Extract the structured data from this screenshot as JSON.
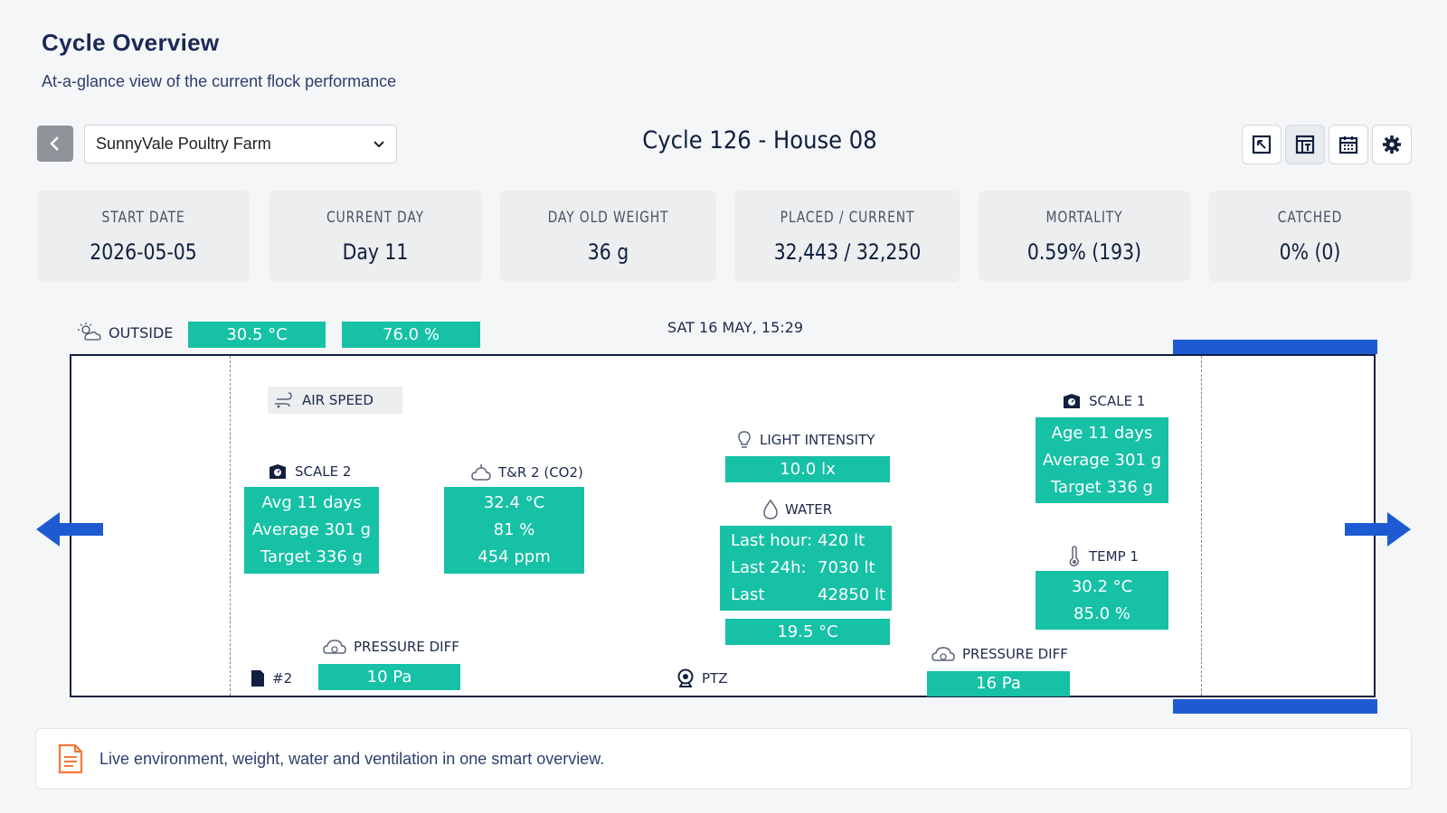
{
  "header": {
    "title": "Cycle Overview",
    "subtitle": "At-a-glance view of the current flock performance"
  },
  "toolbar": {
    "farm": "SunnyVale Poultry Farm",
    "cycle_title": "Cycle 126 - House 08",
    "icons": [
      "expand-icon",
      "layout-icon",
      "calendar-icon",
      "gear-icon"
    ]
  },
  "stats": [
    {
      "label": "START DATE",
      "value": "2026-05-05"
    },
    {
      "label": "CURRENT DAY",
      "value": "Day 11"
    },
    {
      "label": "DAY OLD WEIGHT",
      "value": "36 g"
    },
    {
      "label": "PLACED / CURRENT",
      "value": "32,443 / 32,250"
    },
    {
      "label": "MORTALITY",
      "value": "0.59% (193)"
    },
    {
      "label": "CATCHED",
      "value": "0% (0)"
    }
  ],
  "outside": {
    "label": "OUTSIDE",
    "temp": "30.5 °C",
    "humidity": "76.0 %"
  },
  "datetime": "SAT 16 MAY, 15:29",
  "house": {
    "air_speed": "AIR SPEED",
    "scale2": {
      "label": "SCALE 2",
      "lines": [
        "Avg 11 days",
        "Average 301 g",
        "Target 336 g"
      ]
    },
    "tr2": {
      "label": "T&R 2 (CO2)",
      "lines": [
        "32.4 °C",
        "81 %",
        "454 ppm"
      ]
    },
    "light": {
      "label": "LIGHT INTENSITY",
      "value": "10.0 lx"
    },
    "water": {
      "label": "WATER",
      "rows": [
        {
          "k": "Last hour:",
          "v": "420 lt"
        },
        {
          "k": "Last 24h:",
          "v": "7030 lt"
        },
        {
          "k": "Last week:",
          "v": "42850 lt"
        }
      ],
      "temp": "19.5 °C"
    },
    "scale1": {
      "label": "SCALE 1",
      "lines": [
        "Age 11 days",
        "Average 301 g",
        "Target 336 g"
      ]
    },
    "temp1": {
      "label": "TEMP 1",
      "lines": [
        "30.2 °C",
        "85.0 %"
      ]
    },
    "pressure_left": {
      "label": "PRESSURE DIFF",
      "value": "10 Pa"
    },
    "pressure_right": {
      "label": "PRESSURE DIFF",
      "value": "16 Pa"
    },
    "door": {
      "label": "#2"
    },
    "ptz": {
      "label": "PTZ"
    }
  },
  "footer": {
    "note": "Live environment, weight, water and ventilation in one smart overview."
  },
  "colors": {
    "accent_teal": "#16c1a6",
    "accent_blue": "#1e5bd2",
    "navy": "#12203f",
    "note_icon": "#f07a3a"
  }
}
